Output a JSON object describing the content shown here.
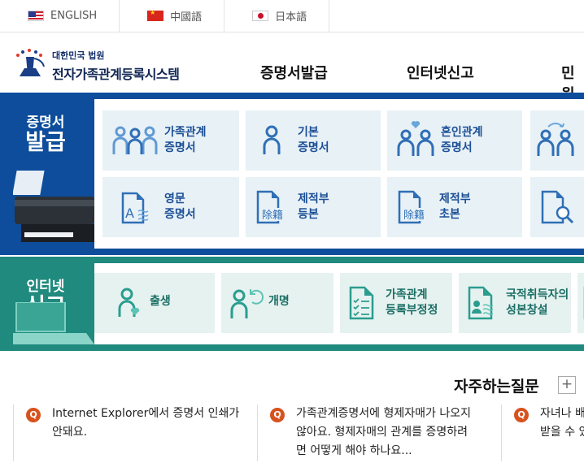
{
  "languages": [
    {
      "label": "ENGLISH",
      "flag": "us-flag"
    },
    {
      "label": "中國語",
      "flag": "cn-flag"
    },
    {
      "label": "日本語",
      "flag": "jp-flag"
    }
  ],
  "logo": {
    "sub": "대한민국 법원",
    "main": "전자가족관계등록시스템"
  },
  "nav": [
    "증명서발급",
    "인터넷신고",
    "민원"
  ],
  "section1": {
    "title_small": "증명서",
    "title_big": "발급",
    "cards": [
      {
        "label": "가족관계\n증명서",
        "icon": "family-icon"
      },
      {
        "label": "기본\n증명서",
        "icon": "person-icon"
      },
      {
        "label": "혼인관계\n증명서",
        "icon": "couple-heart-icon"
      },
      {
        "label": "",
        "icon": "couple-exchange-icon"
      },
      {
        "label": "영문\n증명서",
        "icon": "english-document-icon"
      },
      {
        "label": "제적부\n등본",
        "icon": "register-document-icon",
        "badge": "除籍"
      },
      {
        "label": "제적부\n초본",
        "icon": "register-document-icon",
        "badge": "除籍"
      },
      {
        "label": "",
        "icon": "search-document-icon"
      }
    ]
  },
  "section2": {
    "title_small": "인터넷",
    "title_big": "신고",
    "cards": [
      {
        "label": "출생",
        "icon": "birth-icon"
      },
      {
        "label": "개명",
        "icon": "rename-icon"
      },
      {
        "label": "가족관계\n등록부정정",
        "icon": "checklist-document-icon"
      },
      {
        "label": "국적취득자의\n성본창설",
        "icon": "id-document-icon"
      },
      {
        "label": "",
        "icon": "document-icon"
      }
    ]
  },
  "faq": {
    "title": "자주하는질문",
    "more": "+",
    "badge": "Q",
    "items": [
      "Internet Explorer에서 증명서 인쇄가\n안돼요.",
      "가족관계증명서에 형제자매가 나오지\n않아요. 형제자매의 관계를 증명하려\n면 어떻게 해야 하나요...",
      "자녀나 배\n받을 수 있"
    ]
  },
  "colors": {
    "blue": "#0d4d9b",
    "green": "#1f8a7d",
    "card_blue": "#e8f1f6",
    "icon_blue": "#2f6fb6",
    "icon_green": "#2a9d8f",
    "q_orange": "#d7521d"
  }
}
